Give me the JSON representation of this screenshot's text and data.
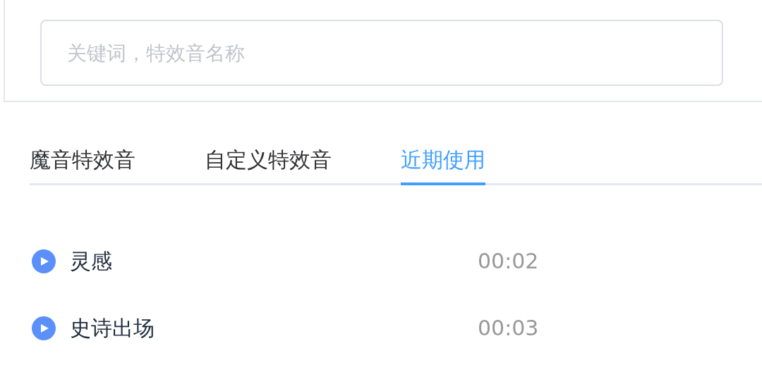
{
  "search": {
    "placeholder": "关键词，特效音名称"
  },
  "tabs": [
    {
      "label": "魔音特效音",
      "selected": false
    },
    {
      "label": "自定义特效音",
      "selected": false
    },
    {
      "label": "近期使用",
      "selected": true
    }
  ],
  "sounds": [
    {
      "name": "灵感",
      "duration": "00:02"
    },
    {
      "name": "史诗出场",
      "duration": "00:03"
    }
  ]
}
